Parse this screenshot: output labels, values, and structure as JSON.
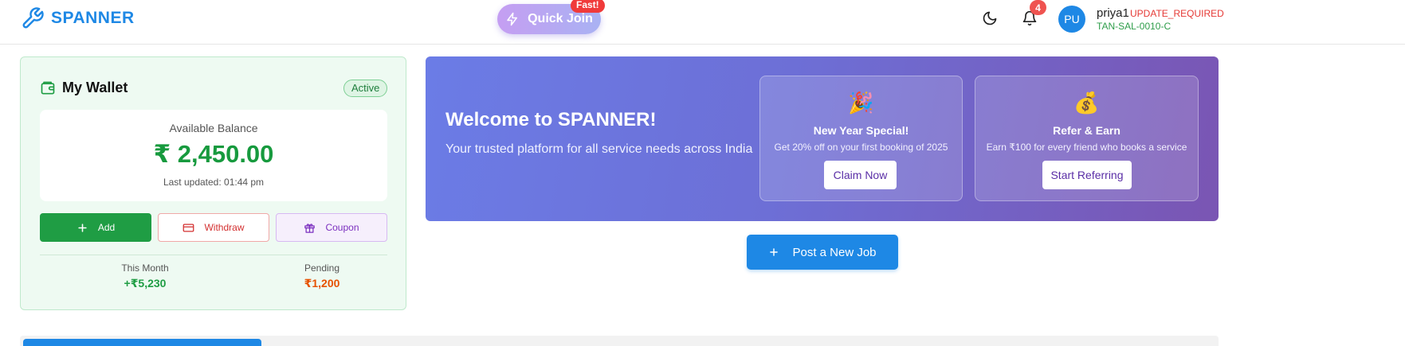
{
  "header": {
    "brand_name": "SPANNER",
    "quick_join_label": "Quick Join",
    "fast_badge": "Fast!",
    "notification_count": "4",
    "avatar_initials": "PU",
    "user_name": "priya1",
    "user_status": "UPDATE_REQUIRED",
    "user_code": "TAN-SAL-0010-C"
  },
  "wallet": {
    "title": "My Wallet",
    "status_badge": "Active",
    "balance_label": "Available Balance",
    "balance_value": "₹ 2,450.00",
    "last_updated": "Last updated: 01:44 pm",
    "buttons": {
      "add": "Add",
      "withdraw": "Withdraw",
      "coupon": "Coupon"
    },
    "stats": {
      "this_month_label": "This Month",
      "this_month_value": "+₹5,230",
      "pending_label": "Pending",
      "pending_value": "₹1,200"
    }
  },
  "banner": {
    "title": "Welcome to SPANNER!",
    "subtitle": "Your trusted platform for all service needs across India",
    "promos": [
      {
        "emoji": "🎉",
        "title": "New Year Special!",
        "description": "Get 20% off on your first booking of 2025",
        "button": "Claim Now"
      },
      {
        "emoji": "💰",
        "title": "Refer & Earn",
        "description": "Earn ₹100 for every friend who books a service",
        "button": "Start Referring"
      }
    ]
  },
  "post_job_label": "Post a New Job",
  "colors": {
    "brand": "#1e88e5",
    "success": "#1f9d44",
    "danger": "#d32f2f",
    "purple": "#7b2fbf",
    "pending": "#e65100"
  },
  "icons": {
    "brand": "wrench-icon",
    "quick_join": "lightning-icon",
    "theme": "moon-icon",
    "notifications": "bell-icon",
    "wallet": "wallet-icon",
    "add": "plus-icon",
    "withdraw": "credit-card-icon",
    "coupon": "gift-icon",
    "post_job": "plus-icon"
  }
}
